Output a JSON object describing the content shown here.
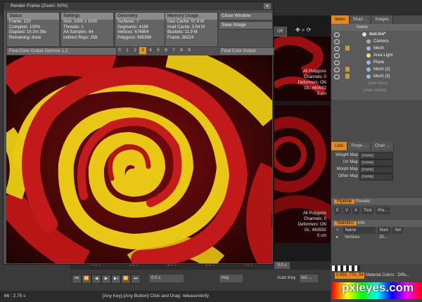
{
  "render_window": {
    "title": "Render Frame (Zoom: 50%)",
    "close_label": "x",
    "status": {
      "header": "Status",
      "lines": [
        "Frame: 120",
        "Complete: 100%",
        "Elapsed: 1h 2m 36s",
        "Remaining: done"
      ]
    },
    "settings": {
      "header": "Settings",
      "lines": [
        "Size: 1000 x 1000",
        "Threads: 1",
        "AA Samples: 64",
        "Indirect Rays: 256"
      ]
    },
    "geometry": {
      "header": "Geometry",
      "lines": [
        "Surfaces: 7",
        "Segments: 4189",
        "Vertices: 676904",
        "Polygons: 995368"
      ]
    },
    "memory": {
      "header": "Memory Usage",
      "lines": [
        "Geo Cache: 97.9 M",
        "Irrad Cache: 3.54 M",
        "Buckets: 11.9 M",
        "Frame: 38224"
      ]
    },
    "close_window_label": "Close Window",
    "save_image_label": "Save Image",
    "gamma_label": "Final Color Output Gamma: 1.2",
    "buffers": [
      "0",
      "1",
      "2",
      "3",
      "4",
      "5",
      "6",
      "7",
      "8",
      "9"
    ],
    "selected_buffer_index": 3,
    "output_select": "Final Color Output"
  },
  "viewport": {
    "dropdown": "Off",
    "top_info": [
      "All Polygons",
      "Channels: 0",
      "Deformers: ON",
      "GL: 663592",
      "5 cm"
    ],
    "bottom_info": [
      "All Polygons",
      "Channels: 0",
      "Deformers: ON",
      "GL: 663592",
      "5 cm"
    ]
  },
  "items_panel": {
    "tabs": [
      "Items",
      "Shad ...",
      "Images"
    ],
    "column_header": "Name",
    "rows": [
      {
        "label": "test.lxo*",
        "icon": "scene-icon"
      },
      {
        "label": "Camera",
        "icon": "camera-icon"
      },
      {
        "label": "Mesh",
        "icon": "mesh-icon"
      },
      {
        "label": "Area Light",
        "icon": "light-icon"
      },
      {
        "label": "Plane",
        "icon": "mesh-icon"
      },
      {
        "label": "Mesh (2)",
        "icon": "mesh-icon"
      },
      {
        "label": "Mesh (3)",
        "icon": "mesh-icon"
      }
    ],
    "new_item": "(new item)",
    "new_scene": "(new scene)"
  },
  "lists_panel": {
    "tabs": [
      "Lists",
      "Prope ...",
      "Chan ..."
    ],
    "maps": [
      {
        "label": "Weight Map",
        "value": "(none)"
      },
      {
        "label": "UV Map",
        "value": "(none)"
      },
      {
        "label": "Morph Map",
        "value": "(none)"
      },
      {
        "label": "Other Map",
        "value": "(none)"
      }
    ]
  },
  "pipeline": {
    "tab": "Pipeline",
    "tab2": "Presets",
    "tools": [
      "E",
      "V",
      "A",
      "Tool",
      "Pre..."
    ]
  },
  "statistics": {
    "tab": "Statistics",
    "tab2": "Info",
    "cols": [
      "Name",
      "Num",
      "Sel"
    ],
    "row": {
      "name": "Vertices",
      "num": "20..."
    }
  },
  "timeline": {
    "ticks": [
      "0.0 s",
      "1.0 s",
      "2.0 s",
      "3.0 s",
      "4.0 s"
    ],
    "current": "5.0 s",
    "time_field": "0.0 s"
  },
  "transport": {
    "key_label": "Key",
    "auto_key": "Auto Key",
    "anim_mode": "Ani ..."
  },
  "statusbar": {
    "left": "66 : 2.75 s",
    "hint": "[Any Key]-[Any Button] Click and Drag: releaseVerify"
  },
  "color": {
    "rgb": "0.950, 770, 04",
    "material_colors": "Material Colors : Diffu...",
    "watermark": "pxleyes.com"
  }
}
